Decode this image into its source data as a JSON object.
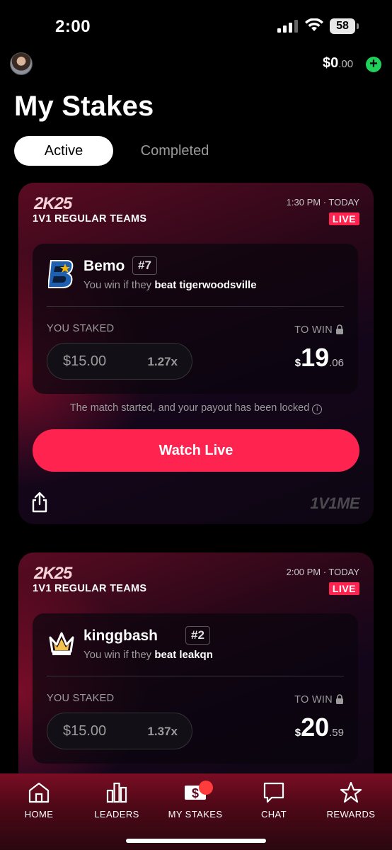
{
  "status_bar": {
    "time": "2:00",
    "battery": "58"
  },
  "header": {
    "balance_whole": "$0",
    "balance_cents": ".00",
    "add_label": "+"
  },
  "page": {
    "title": "My Stakes"
  },
  "segments": {
    "active": "Active",
    "completed": "Completed"
  },
  "stakes": [
    {
      "game": "2K25",
      "mode": "1V1 REGULAR TEAMS",
      "time": "1:30 PM · TODAY",
      "status": "LIVE",
      "player": "Bemo",
      "rank": "#7",
      "condition_prefix": "You win if they ",
      "condition_action": "beat tigerwoodsville",
      "staked_label": "YOU STAKED",
      "to_win_label": "TO WIN",
      "stake_amount": "$15.00",
      "multiplier": "1.27x",
      "payout_currency": "$",
      "payout_whole": "19",
      "payout_frac": ".06",
      "note": "The match started, and your payout has been locked",
      "button": "Watch Live",
      "brand": "1V1ME"
    },
    {
      "game": "2K25",
      "mode": "1V1 REGULAR TEAMS",
      "time": "2:00 PM · TODAY",
      "status": "LIVE",
      "player": "kinggbash",
      "rank": "#2",
      "condition_prefix": "You win if they ",
      "condition_action": "beat leakqn",
      "staked_label": "YOU STAKED",
      "to_win_label": "TO WIN",
      "stake_amount": "$15.00",
      "multiplier": "1.37x",
      "payout_currency": "$",
      "payout_whole": "20",
      "payout_frac": ".59"
    }
  ],
  "tabbar": {
    "items": [
      {
        "label": "HOME",
        "icon": "home-icon"
      },
      {
        "label": "LEADERS",
        "icon": "bar-chart-icon"
      },
      {
        "label": "MY STAKES",
        "icon": "stakes-icon"
      },
      {
        "label": "CHAT",
        "icon": "chat-icon"
      },
      {
        "label": "REWARDS",
        "icon": "star-icon"
      }
    ]
  },
  "colors": {
    "accent": "#ff2350",
    "add_green": "#1fd15a"
  }
}
